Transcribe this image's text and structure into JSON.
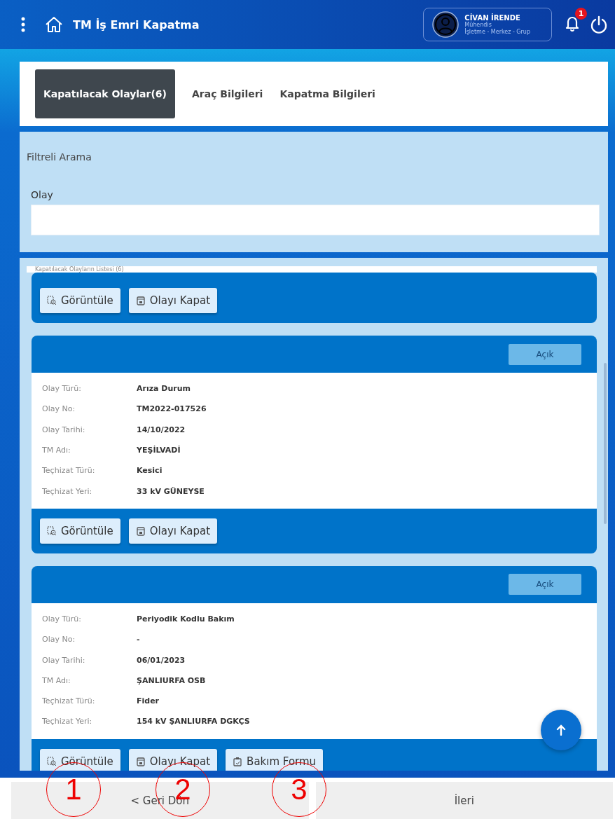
{
  "header": {
    "title": "TM İş Emri Kapatma",
    "user": {
      "name": "CİVAN İRENDE",
      "role": "Mühendis",
      "unit": "İşletme - Merkez - Grup"
    },
    "notifications": "1"
  },
  "tabs": [
    {
      "label": "Kapatılacak Olaylar(6)",
      "selected": true
    },
    {
      "label": "Araç Bilgileri",
      "selected": false
    },
    {
      "label": "Kapatma Bilgileri",
      "selected": false
    }
  ],
  "filter": {
    "title": "Filtreli Arama",
    "field_label": "Olay"
  },
  "list": {
    "title": "Kapatılacak Olayların Listesi (6)",
    "cards": [
      {
        "actions": [
          {
            "kind": "view",
            "label": "Görüntüle"
          },
          {
            "kind": "close",
            "label": "Olayı Kapat"
          }
        ]
      },
      {
        "status": "Açık",
        "fields": [
          {
            "label": "Olay Türü:",
            "value": "Arıza Durum"
          },
          {
            "label": "Olay No:",
            "value": "TM2022-017526"
          },
          {
            "label": "Olay Tarihi:",
            "value": "14/10/2022"
          },
          {
            "label": "TM Adı:",
            "value": "YEŞİLVADİ"
          },
          {
            "label": "Teçhizat Türü:",
            "value": "Kesici"
          },
          {
            "label": "Teçhizat Yeri:",
            "value": "33 kV GÜNEYSE"
          }
        ],
        "actions": [
          {
            "kind": "view",
            "label": "Görüntüle"
          },
          {
            "kind": "close",
            "label": "Olayı Kapat"
          }
        ]
      },
      {
        "status": "Açık",
        "fields": [
          {
            "label": "Olay Türü:",
            "value": "Periyodik Kodlu Bakım"
          },
          {
            "label": "Olay No:",
            "value": "-"
          },
          {
            "label": "Olay Tarihi:",
            "value": "06/01/2023"
          },
          {
            "label": "TM Adı:",
            "value": "ŞANLIURFA OSB"
          },
          {
            "label": "Teçhizat Türü:",
            "value": "Fider"
          },
          {
            "label": "Teçhizat Yeri:",
            "value": "154 kV ŞANLIURFA DGKÇS"
          }
        ],
        "actions": [
          {
            "kind": "view",
            "label": "Görüntüle"
          },
          {
            "kind": "close",
            "label": "Olayı Kapat"
          },
          {
            "kind": "form",
            "label": "Bakım Formu"
          }
        ]
      }
    ]
  },
  "footer": {
    "back": "< Geri Dön",
    "next": "İleri"
  },
  "annotations": [
    {
      "label": "1"
    },
    {
      "label": "2"
    },
    {
      "label": "3"
    }
  ]
}
